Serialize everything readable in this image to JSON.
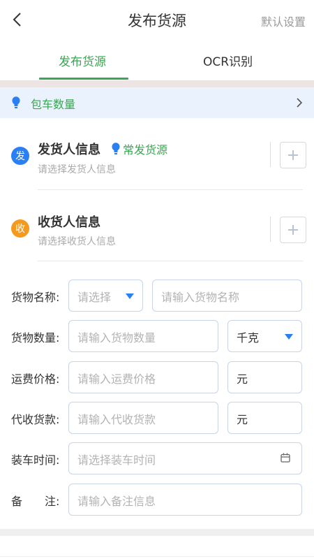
{
  "header": {
    "title": "发布货源",
    "default_settings": "默认设置"
  },
  "tabs": [
    {
      "label": "发布货源",
      "active": true
    },
    {
      "label": "OCR识别",
      "active": false
    }
  ],
  "charter": {
    "label": "包车数量"
  },
  "sender": {
    "badge": "发",
    "title": "发货人信息",
    "frequent_label": "常发货源",
    "placeholder": "请选择发货人信息"
  },
  "receiver": {
    "badge": "收",
    "title": "收货人信息",
    "placeholder": "请选择收货人信息"
  },
  "form": {
    "goods_name": {
      "label": "货物名称:",
      "select_placeholder": "请选择",
      "input_placeholder": "请输入货物名称"
    },
    "goods_quantity": {
      "label": "货物数量:",
      "input_placeholder": "请输入货物数量",
      "unit": "千克"
    },
    "freight_price": {
      "label": "运费价格:",
      "input_placeholder": "请输入运费价格",
      "unit": "元"
    },
    "cod_amount": {
      "label": "代收货款:",
      "input_placeholder": "请输入代收货款",
      "unit": "元"
    },
    "loading_time": {
      "label": "装车时间:",
      "input_placeholder": "请选择装车时间"
    },
    "remarks": {
      "label": "备　　注:",
      "input_placeholder": "请输入备注信息"
    }
  },
  "colors": {
    "accent_green": "#3aa552",
    "sender_blue": "#2a7ff3",
    "receiver_orange": "#f39a1f",
    "info_bar_bg": "#eaf2fd"
  }
}
